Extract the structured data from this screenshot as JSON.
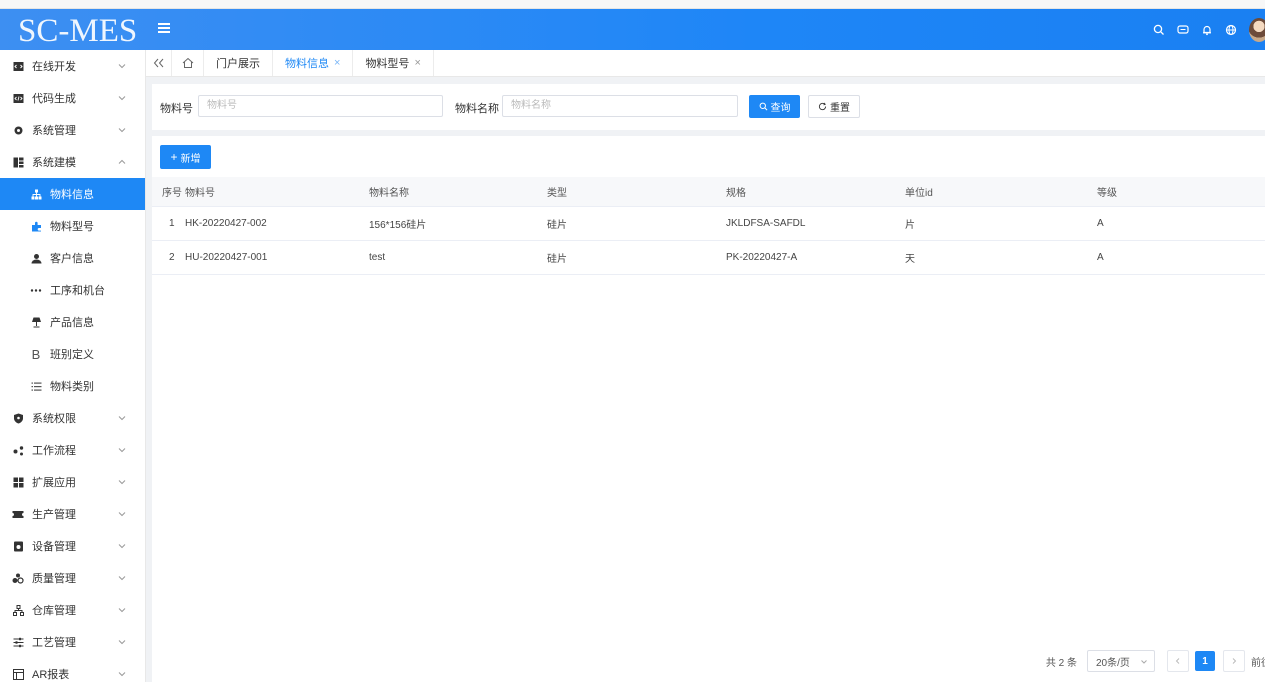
{
  "app": {
    "logo": "SC-MES"
  },
  "colors": {
    "primary": "#1e88f5",
    "header_bg": "#1e86f7",
    "sidebar_active": "#1e88f5"
  },
  "sidebar": {
    "items": [
      {
        "label": "在线开发",
        "icon": "code-box-icon",
        "expandable": true
      },
      {
        "label": "代码生成",
        "icon": "code-gen-icon",
        "expandable": true
      },
      {
        "label": "系统管理",
        "icon": "settings-icon",
        "expandable": true
      },
      {
        "label": "系统建模",
        "icon": "modeling-icon",
        "expandable": true,
        "expanded": true
      },
      {
        "label": "物料信息",
        "icon": "sitemap-icon",
        "sub": true,
        "active": true
      },
      {
        "label": "物料型号",
        "icon": "puzzle-icon",
        "sub": true
      },
      {
        "label": "客户信息",
        "icon": "user-icon",
        "sub": true
      },
      {
        "label": "工序和机台",
        "icon": "dots-icon",
        "sub": true
      },
      {
        "label": "产品信息",
        "icon": "lamp-icon",
        "sub": true
      },
      {
        "label": "班别定义",
        "icon": "letter-b-icon",
        "sub": true
      },
      {
        "label": "物料类别",
        "icon": "list-icon",
        "sub": true
      },
      {
        "label": "系统权限",
        "icon": "shield-icon",
        "expandable": true
      },
      {
        "label": "工作流程",
        "icon": "workflow-icon",
        "expandable": true
      },
      {
        "label": "扩展应用",
        "icon": "apps-icon",
        "expandable": true
      },
      {
        "label": "生产管理",
        "icon": "production-icon",
        "expandable": true
      },
      {
        "label": "设备管理",
        "icon": "device-icon",
        "expandable": true
      },
      {
        "label": "质量管理",
        "icon": "quality-icon",
        "expandable": true
      },
      {
        "label": "仓库管理",
        "icon": "warehouse-icon",
        "expandable": true
      },
      {
        "label": "工艺管理",
        "icon": "process-icon",
        "expandable": true
      },
      {
        "label": "AR报表",
        "icon": "report-icon",
        "expandable": true
      }
    ]
  },
  "tabs": [
    {
      "label": "门户展示",
      "closable": false
    },
    {
      "label": "物料信息",
      "closable": true,
      "active": true
    },
    {
      "label": "物料型号",
      "closable": true
    }
  ],
  "search": {
    "material_no_label": "物料号",
    "material_no_placeholder": "物料号",
    "material_name_label": "物料名称",
    "material_name_placeholder": "物料名称",
    "query_label": "查询",
    "reset_label": "重置"
  },
  "toolbar": {
    "add_label": "新增"
  },
  "table": {
    "columns": [
      "序号",
      "物料号",
      "物料名称",
      "类型",
      "规格",
      "单位id",
      "等级"
    ],
    "rows": [
      [
        "1",
        "HK-20220427-002",
        "156*156硅片",
        "硅片",
        "JKLDFSA-SAFDL",
        "片",
        "A"
      ],
      [
        "2",
        "HU-20220427-001",
        "test",
        "硅片",
        "PK-20220427-A",
        "天",
        "A"
      ]
    ]
  },
  "pagination": {
    "total_text": "共 2 条",
    "page_size": "20条/页",
    "current_page": "1",
    "goto_text": "前往"
  }
}
